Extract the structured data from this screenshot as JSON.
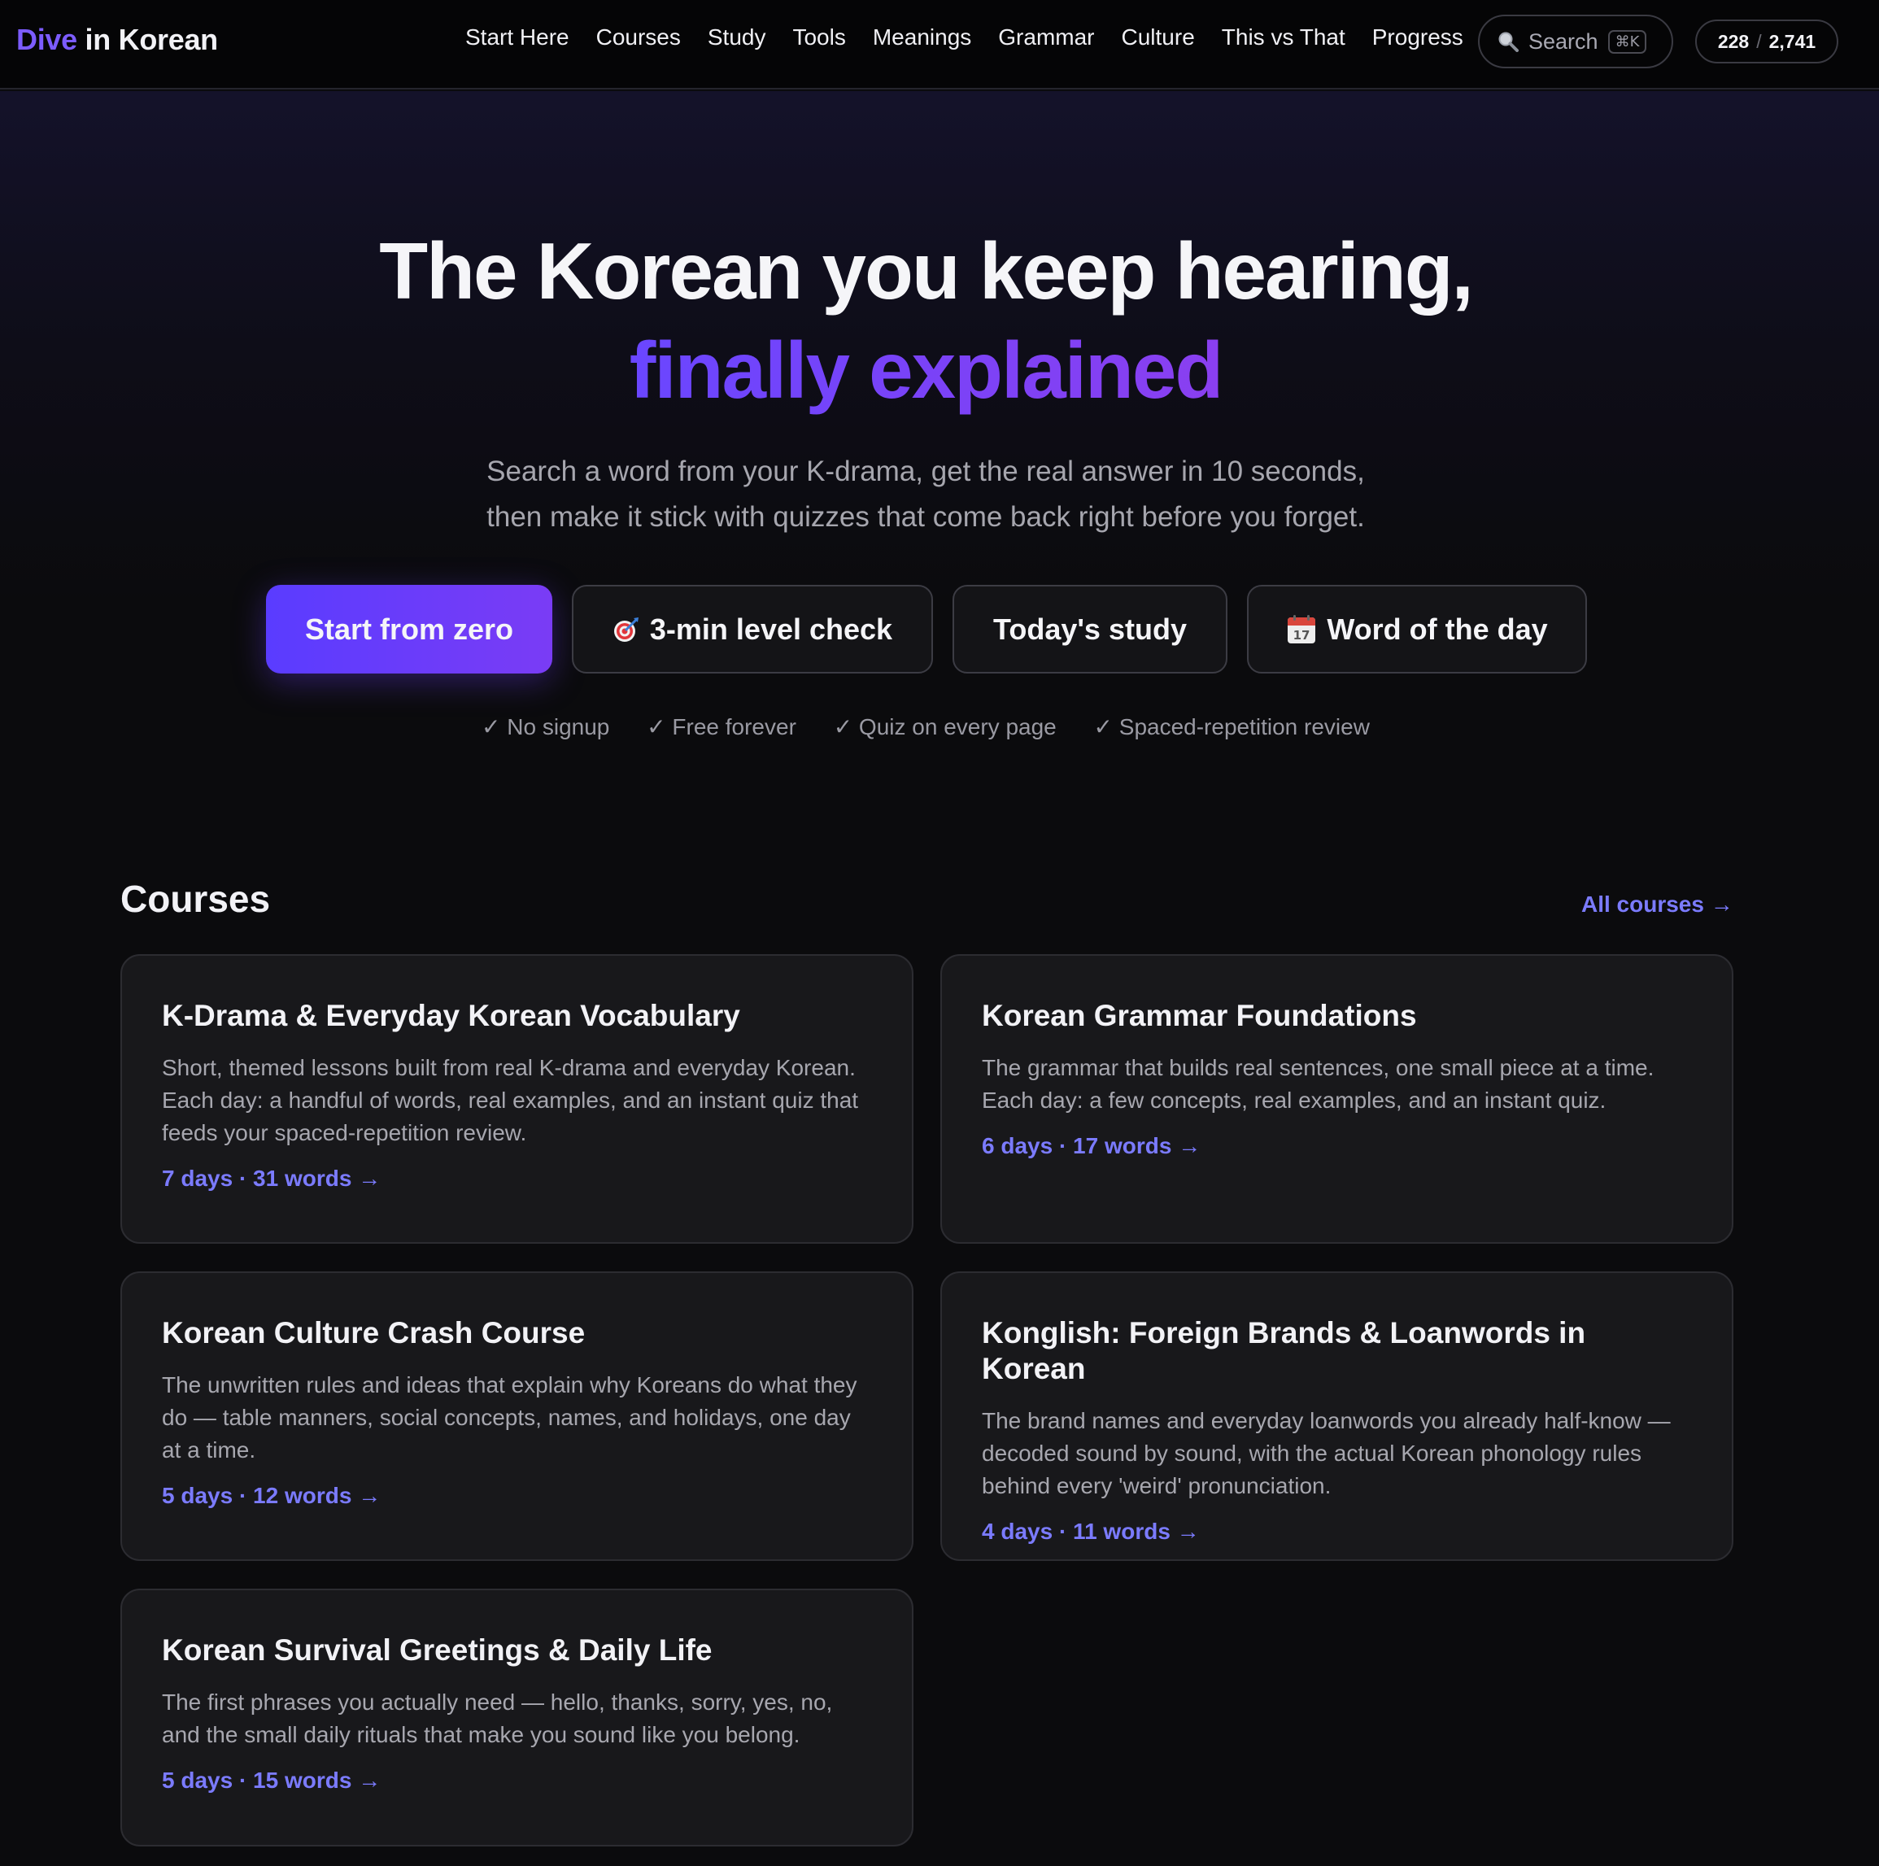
{
  "header": {
    "logo_part1": "Dive",
    "logo_part2": "in Korean",
    "nav": [
      "Start Here",
      "Courses",
      "Study",
      "Tools",
      "Meanings",
      "Grammar",
      "Culture",
      "This vs That",
      "Progress"
    ],
    "search_placeholder": "Search",
    "search_shortcut": "⌘K",
    "progress_done": "228",
    "progress_total": "2,741"
  },
  "hero": {
    "headline_line1": "The Korean you keep hearing,",
    "headline_line2": "finally explained",
    "subtitle_line1": "Search a word from your K-drama, get the real answer in 10 seconds,",
    "subtitle_line2": "then make it stick with quizzes that come back right before you forget.",
    "buttons": {
      "start": "Start from zero",
      "level": "3-min level check",
      "study": "Today's study",
      "word": "Word of the day"
    },
    "checks": [
      "✓ No signup",
      "✓ Free forever",
      "✓ Quiz on every page",
      "✓ Spaced-repetition review"
    ]
  },
  "courses": {
    "title": "Courses",
    "all_link": "All courses →",
    "items": [
      {
        "title": "K-Drama & Everyday Korean Vocabulary",
        "desc": "Short, themed lessons built from real K-drama and everyday Korean. Each day: a handful of words, real examples, and an instant quiz that feeds your spaced-repetition review.",
        "meta": "7 days · 31 words →"
      },
      {
        "title": "Korean Grammar Foundations",
        "desc": "The grammar that builds real sentences, one small piece at a time. Each day: a few concepts, real examples, and an instant quiz.",
        "meta": "6 days · 17 words →"
      },
      {
        "title": "Korean Culture Crash Course",
        "desc": "The unwritten rules and ideas that explain why Koreans do what they do — table manners, social concepts, names, and holidays, one day at a time.",
        "meta": "5 days · 12 words →"
      },
      {
        "title": "Konglish: Foreign Brands & Loanwords in Korean",
        "desc": "The brand names and everyday loanwords you already half-know — decoded sound by sound, with the actual Korean phonology rules behind every 'weird' pronunciation.",
        "meta": "4 days · 11 words →"
      },
      {
        "title": "Korean Survival Greetings & Daily Life",
        "desc": "The first phrases you actually need — hello, thanks, sorry, yes, no, and the small daily rituals that make you sound like you belong.",
        "meta": "5 days · 15 words →"
      }
    ]
  },
  "colors": {
    "accent": "#7c5cff",
    "link": "#7b7bff",
    "background": "#0b0b0d",
    "card": "#18181b"
  },
  "icons": {
    "search": "magnifier-icon",
    "level": "target-icon",
    "word": "calendar-icon"
  }
}
